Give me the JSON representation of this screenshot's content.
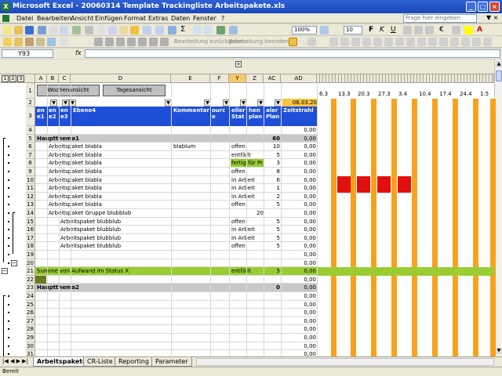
{
  "window": {
    "title": "Microsoft Excel - 20060314 Template Trackingliste Arbeitspakete.xls"
  },
  "menu": {
    "items": [
      "Datei",
      "Bearbeiten",
      "Ansicht",
      "Einfügen",
      "Format",
      "Extras",
      "Daten",
      "Fenster",
      "?"
    ],
    "help_placeholder": "Frage hier eingeben"
  },
  "toolbar": {
    "zoom": "100%",
    "font_size": "10",
    "review_edit": "Bearbeitung zurückgeben...",
    "review_end": "Bearbeitung beenden..."
  },
  "formula": {
    "namebox": "Y93",
    "fx": "fx",
    "value": ""
  },
  "sheet": {
    "outline_levels": [
      "1",
      "2",
      "3"
    ],
    "columns": [
      "A",
      "B",
      "C",
      "D",
      "E",
      "F",
      "Y",
      "Z",
      "AC",
      "AD"
    ],
    "buttons": {
      "week": "Wochenansicht",
      "day": "Tagesansicht"
    },
    "date_cell": "06.03.20",
    "gantt_dates": [
      "6.3",
      "13.3",
      "20.3",
      "27.3",
      "3.4",
      "10.4",
      "17.4",
      "24.4",
      "1.5"
    ],
    "header": {
      "a": "en e1",
      "b": "en e2",
      "c": "en e3",
      "d": "Ebene4",
      "e": "Kommentar",
      "f": "ourc e",
      "y": "eller Stat",
      "z": "hen plan",
      "ac": "aler Plan",
      "ad": "Zeitstrahl"
    },
    "rows": [
      {
        "n": "4",
        "d": "",
        "e": "",
        "y": "",
        "z": "",
        "ac": "",
        "ad": "0,00"
      },
      {
        "n": "5",
        "d": "Hauptthema1",
        "e": "",
        "y": "",
        "z": "",
        "ac": "60",
        "ad": "0,00",
        "hl": "grey"
      },
      {
        "n": "6",
        "d": "Arbeitspaket blabla",
        "e": "blablum",
        "y": "offen",
        "z": "",
        "ac": "10",
        "ad": "0,00"
      },
      {
        "n": "7",
        "d": "Arbeitspaket blabla",
        "e": "",
        "y": "entfällt",
        "z": "",
        "ac": "5",
        "ad": "0,00"
      },
      {
        "n": "8",
        "d": "Arbeitspaket blabla",
        "e": "",
        "y": "fertig für Pr",
        "z": "",
        "ac": "3",
        "ad": "0,00"
      },
      {
        "n": "9",
        "d": "Arbeitspaket blabla",
        "e": "",
        "y": "offen",
        "z": "",
        "ac": "8",
        "ad": "0,00"
      },
      {
        "n": "10",
        "d": "Arbeitspaket blabla",
        "e": "",
        "y": "in Arbeit",
        "z": "",
        "ac": "6",
        "ad": "0,00"
      },
      {
        "n": "11",
        "d": "Arbeitspaket blabla",
        "e": "",
        "y": "in Arbeit",
        "z": "",
        "ac": "1",
        "ad": "0,00"
      },
      {
        "n": "12",
        "d": "Arbeitspaket blabla",
        "e": "",
        "y": "in Arbeit",
        "z": "",
        "ac": "2",
        "ad": "0,00"
      },
      {
        "n": "13",
        "d": "Arbeitspaket blabla",
        "e": "",
        "y": "offen",
        "z": "",
        "ac": "5",
        "ad": "0,00"
      },
      {
        "n": "14",
        "d": "Arbeitspaket Gruppe blubblub",
        "e": "",
        "y": "",
        "z": "20",
        "ac": "",
        "ad": "0,00"
      },
      {
        "n": "15",
        "d": "Arbeitspaket blubblub",
        "e": "",
        "y": "offen",
        "z": "",
        "ac": "5",
        "ad": "0,00"
      },
      {
        "n": "16",
        "d": "Arbeitspaket blubblub",
        "e": "",
        "y": "in Arbeit",
        "z": "",
        "ac": "5",
        "ad": "0,00"
      },
      {
        "n": "17",
        "d": "Arbeitspaket blubblub",
        "e": "",
        "y": "in Arbeit",
        "z": "",
        "ac": "5",
        "ad": "0,00"
      },
      {
        "n": "18",
        "d": "Arbeitspaket blubblub",
        "e": "",
        "y": "offen",
        "z": "",
        "ac": "5",
        "ad": "0,00"
      },
      {
        "n": "19",
        "d": "",
        "e": "",
        "y": "",
        "z": "",
        "ac": "",
        "ad": "0,00"
      },
      {
        "n": "20",
        "d": "",
        "e": "",
        "y": "",
        "z": "",
        "ac": "",
        "ad": "0,00"
      },
      {
        "n": "21",
        "d": "Summe von Aufwand im Status X",
        "e": "",
        "y": "entfällt",
        "z": "",
        "ac": "5",
        "ad": "0,00",
        "hl": "green"
      },
      {
        "n": "22",
        "d": "",
        "e": "",
        "y": "",
        "z": "",
        "ac": "",
        "ad": "0,00"
      },
      {
        "n": "23",
        "d": "Hauptthema2",
        "e": "",
        "y": "",
        "z": "",
        "ac": "0",
        "ad": "0,00",
        "hl": "grey"
      },
      {
        "n": "24",
        "d": "",
        "e": "",
        "y": "",
        "z": "",
        "ac": "",
        "ad": "0,00"
      },
      {
        "n": "25",
        "d": "",
        "e": "",
        "y": "",
        "z": "",
        "ac": "",
        "ad": "0,00"
      },
      {
        "n": "26",
        "d": "",
        "e": "",
        "y": "",
        "z": "",
        "ac": "",
        "ad": "0,00"
      },
      {
        "n": "27",
        "d": "",
        "e": "",
        "y": "",
        "z": "",
        "ac": "",
        "ad": "0,00"
      },
      {
        "n": "28",
        "d": "",
        "e": "",
        "y": "",
        "z": "",
        "ac": "",
        "ad": "0,00"
      },
      {
        "n": "29",
        "d": "",
        "e": "",
        "y": "",
        "z": "",
        "ac": "",
        "ad": "0,00"
      },
      {
        "n": "30",
        "d": "",
        "e": "",
        "y": "",
        "z": "",
        "ac": "",
        "ad": "0,00"
      },
      {
        "n": "31",
        "d": "",
        "e": "",
        "y": "",
        "z": "",
        "ac": "",
        "ad": "0,00"
      }
    ]
  },
  "tabs": [
    "Arbeitspakete",
    "CR-Liste",
    "Reporting",
    "Parameter"
  ],
  "status": "Bereit",
  "colors": {
    "header_blue": "#1e4fd8",
    "gantt_orange": "#f7a21d",
    "gantt_red": "#e01010",
    "green_row": "#9acd32",
    "grey_row": "#c8c8c8"
  }
}
